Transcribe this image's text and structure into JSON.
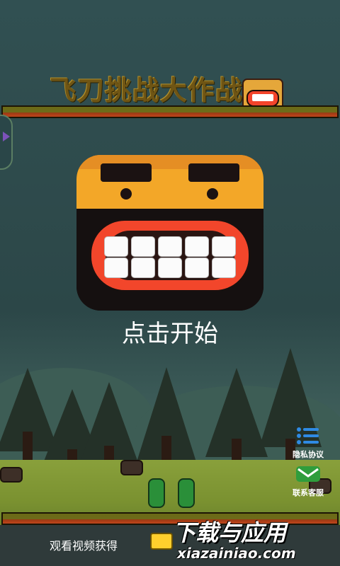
{
  "game": {
    "title": "飞刀挑战大作战",
    "start_label": "点击开始",
    "watch_video_label": "观看视频获得"
  },
  "side_buttons": {
    "privacy": {
      "label": "隐私协议",
      "icon": "list-icon"
    },
    "support": {
      "label": "联系客服",
      "icon": "mail-icon"
    }
  },
  "watermark": {
    "title": "下载与应用",
    "subtitle": "xiazainiao.com"
  },
  "colors": {
    "background": "#2f4a4c",
    "face_orange": "#f3a728",
    "mouth_red": "#f2462b",
    "bar_olive": "#6e6b1a",
    "bar_red": "#c1461c",
    "privacy_blue": "#2f8ae3",
    "support_green": "#2f9d3c"
  }
}
